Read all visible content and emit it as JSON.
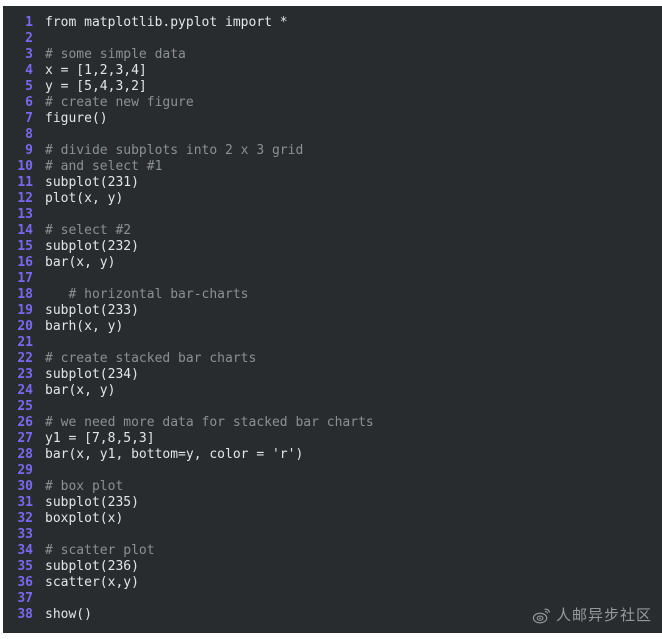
{
  "editor": {
    "language": "python",
    "background_color": "#282c2f",
    "line_number_color": "#7b68ee",
    "code_color": "#e3e6e8",
    "comment_color": "#8a9093",
    "lines": [
      {
        "n": "1",
        "text": "from matplotlib.pyplot import *",
        "comment": false
      },
      {
        "n": "2",
        "text": "",
        "comment": false
      },
      {
        "n": "3",
        "text": "# some simple data",
        "comment": true
      },
      {
        "n": "4",
        "text": "x = [1,2,3,4]",
        "comment": false
      },
      {
        "n": "5",
        "text": "y = [5,4,3,2]",
        "comment": false
      },
      {
        "n": "6",
        "text": "# create new figure",
        "comment": true
      },
      {
        "n": "7",
        "text": "figure()",
        "comment": false
      },
      {
        "n": "8",
        "text": "",
        "comment": false
      },
      {
        "n": "9",
        "text": "# divide subplots into 2 x 3 grid",
        "comment": true
      },
      {
        "n": "10",
        "text": "# and select #1",
        "comment": true
      },
      {
        "n": "11",
        "text": "subplot(231)",
        "comment": false
      },
      {
        "n": "12",
        "text": "plot(x, y)",
        "comment": false
      },
      {
        "n": "13",
        "text": "",
        "comment": false
      },
      {
        "n": "14",
        "text": "# select #2",
        "comment": true
      },
      {
        "n": "15",
        "text": "subplot(232)",
        "comment": false
      },
      {
        "n": "16",
        "text": "bar(x, y)",
        "comment": false
      },
      {
        "n": "17",
        "text": "",
        "comment": false
      },
      {
        "n": "18",
        "text": "   # horizontal bar-charts",
        "comment": true
      },
      {
        "n": "19",
        "text": "subplot(233)",
        "comment": false
      },
      {
        "n": "20",
        "text": "barh(x, y)",
        "comment": false
      },
      {
        "n": "21",
        "text": "",
        "comment": false
      },
      {
        "n": "22",
        "text": "# create stacked bar charts",
        "comment": true
      },
      {
        "n": "23",
        "text": "subplot(234)",
        "comment": false
      },
      {
        "n": "24",
        "text": "bar(x, y)",
        "comment": false
      },
      {
        "n": "25",
        "text": "",
        "comment": false
      },
      {
        "n": "26",
        "text": "# we need more data for stacked bar charts",
        "comment": true
      },
      {
        "n": "27",
        "text": "y1 = [7,8,5,3]",
        "comment": false
      },
      {
        "n": "28",
        "text": "bar(x, y1, bottom=y, color = 'r')",
        "comment": false
      },
      {
        "n": "29",
        "text": "",
        "comment": false
      },
      {
        "n": "30",
        "text": "# box plot",
        "comment": true
      },
      {
        "n": "31",
        "text": "subplot(235)",
        "comment": false
      },
      {
        "n": "32",
        "text": "boxplot(x)",
        "comment": false
      },
      {
        "n": "33",
        "text": "",
        "comment": false
      },
      {
        "n": "34",
        "text": "# scatter plot",
        "comment": true
      },
      {
        "n": "35",
        "text": "subplot(236)",
        "comment": false
      },
      {
        "n": "36",
        "text": "scatter(x,y)",
        "comment": false
      },
      {
        "n": "37",
        "text": "",
        "comment": false
      },
      {
        "n": "38",
        "text": "show()",
        "comment": false
      }
    ]
  },
  "watermark": {
    "icon": "weibo-logo-icon",
    "text": "人邮异步社区"
  }
}
